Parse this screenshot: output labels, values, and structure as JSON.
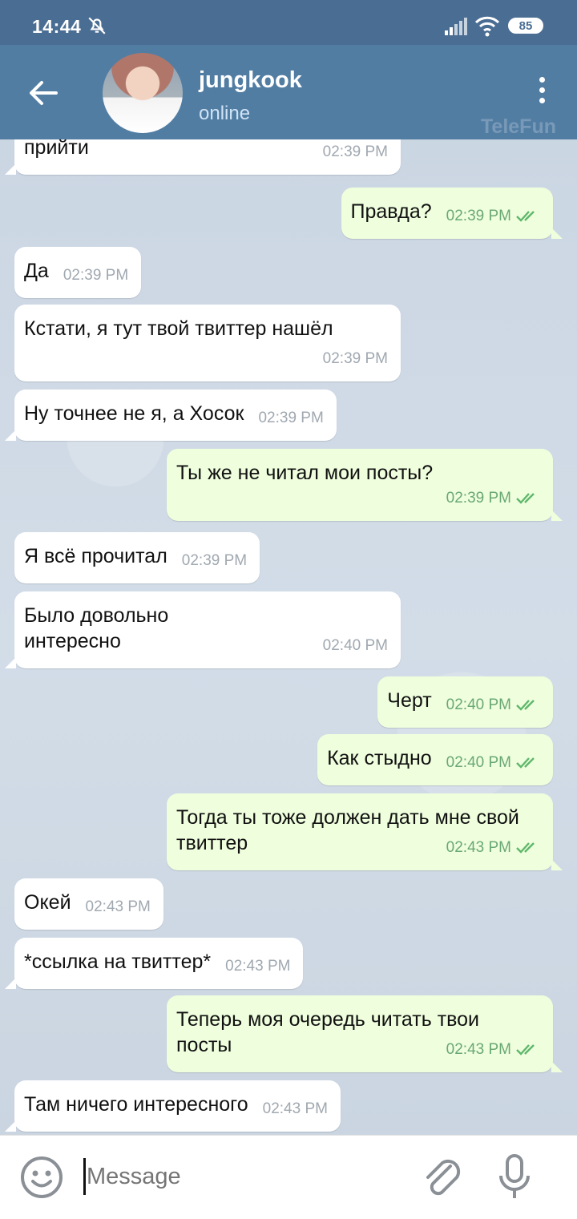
{
  "status_bar": {
    "time": "14:44",
    "battery": "85"
  },
  "header": {
    "name": "jungkook",
    "status": "online",
    "watermark": "TeleFun"
  },
  "messages": [
    {
      "dir": "in",
      "text": "прийти",
      "time": "02:39 PM"
    },
    {
      "dir": "out",
      "text": "Правда?",
      "time": "02:39 PM"
    },
    {
      "dir": "in",
      "text": "Да",
      "time": "02:39 PM"
    },
    {
      "dir": "in",
      "text": "Кстати, я тут твой твиттер нашёл",
      "time": "02:39 PM"
    },
    {
      "dir": "in",
      "text": "Ну точнее не я, а Хосок",
      "time": "02:39 PM"
    },
    {
      "dir": "out",
      "text": "Ты же не читал мои посты?",
      "time": "02:39 PM"
    },
    {
      "dir": "in",
      "text": "Я всё прочитал",
      "time": "02:39 PM"
    },
    {
      "dir": "in",
      "text": "Было довольно интересно",
      "time": "02:40 PM"
    },
    {
      "dir": "out",
      "text": "Черт",
      "time": "02:40 PM"
    },
    {
      "dir": "out",
      "text": "Как стыдно",
      "time": "02:40 PM"
    },
    {
      "dir": "out",
      "text": "Тогда ты тоже должен дать мне свой твиттер",
      "time": "02:43 PM"
    },
    {
      "dir": "in",
      "text": "Окей",
      "time": "02:43 PM"
    },
    {
      "dir": "in",
      "text": "*ссылка на твиттер*",
      "time": "02:43 PM"
    },
    {
      "dir": "out",
      "text": "Теперь моя очередь читать твои посты",
      "time": "02:43 PM"
    },
    {
      "dir": "in",
      "text": "Там ничего интересного",
      "time": "02:43 PM"
    }
  ],
  "input": {
    "placeholder": "Message"
  },
  "colors": {
    "header": "#527da3",
    "status_bar": "#4a6d93",
    "outgoing": "#effedd",
    "incoming": "#ffffff",
    "read_check": "#5fb86c"
  }
}
